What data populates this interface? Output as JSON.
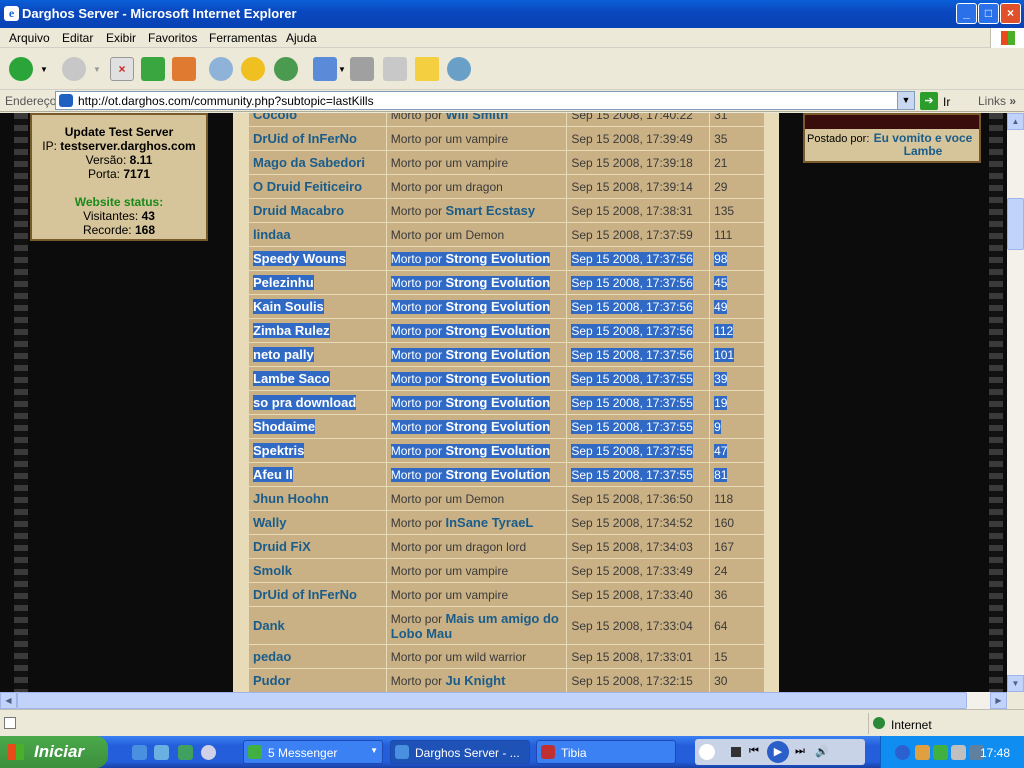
{
  "window": {
    "title": "Darghos Server - Microsoft Internet Explorer",
    "app_icon": "e"
  },
  "menu": [
    "Arquivo",
    "Editar",
    "Exibir",
    "Favoritos",
    "Ferramentas",
    "Ajuda"
  ],
  "address": {
    "label": "Endereço",
    "url": "http://ot.darghos.com/community.php?subtopic=lastKills",
    "go_label": "Ir",
    "links_label": "Links",
    "more": "»"
  },
  "server": {
    "title": "Update Test Server",
    "ip_label": "IP:",
    "ip": "testserver.darghos.com",
    "version_label": "Versão:",
    "version": "8.11",
    "port_label": "Porta:",
    "port": "7171",
    "status_title": "Website status:",
    "visitors_label": "Visitantes:",
    "visitors": "43",
    "record_label": "Recorde:",
    "record": "168"
  },
  "post": {
    "label": "Postado por:",
    "author": "Eu vomito e voce Lambe"
  },
  "kills": [
    {
      "name": "Cocolo",
      "prefix": "Morto por",
      "killer": "Will Smith",
      "date": "Sep 15 2008, 17:40:22",
      "level": "31",
      "selected": false
    },
    {
      "name": "DrUid of InFerNo",
      "prefix": "Morto por um vampire",
      "killer": "",
      "date": "Sep 15 2008, 17:39:49",
      "level": "35",
      "selected": false
    },
    {
      "name": "Mago da Sabedori",
      "prefix": "Morto por um vampire",
      "killer": "",
      "date": "Sep 15 2008, 17:39:18",
      "level": "21",
      "selected": false
    },
    {
      "name": "O Druid Feiticeiro",
      "prefix": "Morto por um dragon",
      "killer": "",
      "date": "Sep 15 2008, 17:39:14",
      "level": "29",
      "selected": false
    },
    {
      "name": "Druid Macabro",
      "prefix": "Morto por",
      "killer": "Smart Ecstasy",
      "date": "Sep 15 2008, 17:38:31",
      "level": "135",
      "selected": false
    },
    {
      "name": "lindaa",
      "prefix": "Morto por um Demon",
      "killer": "",
      "date": "Sep 15 2008, 17:37:59",
      "level": "111",
      "selected": false
    },
    {
      "name": "Speedy Wouns",
      "prefix": "Morto por",
      "killer": "Strong Evolution",
      "date": "Sep 15 2008, 17:37:56",
      "level": "98",
      "selected": true
    },
    {
      "name": "Pelezinhu",
      "prefix": "Morto por",
      "killer": "Strong Evolution",
      "date": "Sep 15 2008, 17:37:56",
      "level": "45",
      "selected": true
    },
    {
      "name": "Kain Soulis",
      "prefix": "Morto por",
      "killer": "Strong Evolution",
      "date": "Sep 15 2008, 17:37:56",
      "level": "49",
      "selected": true
    },
    {
      "name": "Zimba Rulez",
      "prefix": "Morto por",
      "killer": "Strong Evolution",
      "date": "Sep 15 2008, 17:37:56",
      "level": "112",
      "selected": true
    },
    {
      "name": "neto pally",
      "prefix": "Morto por",
      "killer": "Strong Evolution",
      "date": "Sep 15 2008, 17:37:56",
      "level": "101",
      "selected": true
    },
    {
      "name": "Lambe Saco",
      "prefix": "Morto por",
      "killer": "Strong Evolution",
      "date": "Sep 15 2008, 17:37:55",
      "level": "39",
      "selected": true
    },
    {
      "name": "so pra download",
      "prefix": "Morto por",
      "killer": "Strong Evolution",
      "date": "Sep 15 2008, 17:37:55",
      "level": "19",
      "selected": true
    },
    {
      "name": "Shodaime",
      "prefix": "Morto por",
      "killer": "Strong Evolution",
      "date": "Sep 15 2008, 17:37:55",
      "level": "9",
      "selected": true
    },
    {
      "name": "Spektris",
      "prefix": "Morto por",
      "killer": "Strong Evolution",
      "date": "Sep 15 2008, 17:37:55",
      "level": "47",
      "selected": true
    },
    {
      "name": "Afeu II",
      "prefix": "Morto por",
      "killer": "Strong Evolution",
      "date": "Sep 15 2008, 17:37:55",
      "level": "81",
      "selected": true
    },
    {
      "name": "Jhun Hoohn",
      "prefix": "Morto por um Demon",
      "killer": "",
      "date": "Sep 15 2008, 17:36:50",
      "level": "118",
      "selected": false
    },
    {
      "name": "Wally",
      "prefix": "Morto por",
      "killer": "InSane TyraeL",
      "date": "Sep 15 2008, 17:34:52",
      "level": "160",
      "selected": false
    },
    {
      "name": "Druid FiX",
      "prefix": "Morto por um dragon lord",
      "killer": "",
      "date": "Sep 15 2008, 17:34:03",
      "level": "167",
      "selected": false
    },
    {
      "name": "Smolk",
      "prefix": "Morto por um vampire",
      "killer": "",
      "date": "Sep 15 2008, 17:33:49",
      "level": "24",
      "selected": false
    },
    {
      "name": "DrUid of InFerNo",
      "prefix": "Morto por um vampire",
      "killer": "",
      "date": "Sep 15 2008, 17:33:40",
      "level": "36",
      "selected": false
    },
    {
      "name": "Dank",
      "prefix": "Morto por",
      "killer": "Mais um amigo do Lobo Mau",
      "date": "Sep 15 2008, 17:33:04",
      "level": "64",
      "selected": false,
      "tall": true
    },
    {
      "name": "pedao",
      "prefix": "Morto por um wild warrior",
      "killer": "",
      "date": "Sep 15 2008, 17:33:01",
      "level": "15",
      "selected": false
    },
    {
      "name": "Pudor",
      "prefix": "Morto por",
      "killer": "Ju Knight",
      "date": "Sep 15 2008, 17:32:15",
      "level": "30",
      "selected": false
    }
  ],
  "status": {
    "zone": "Internet"
  },
  "taskbar": {
    "start": "Iniciar",
    "tasks": [
      {
        "label": "5 Messenger",
        "icon": "messenger-icon"
      },
      {
        "label": "Darghos Server - ...",
        "icon": "ie-icon"
      },
      {
        "label": "Tibia",
        "icon": "tibia-icon"
      }
    ],
    "clock": "17:48"
  }
}
